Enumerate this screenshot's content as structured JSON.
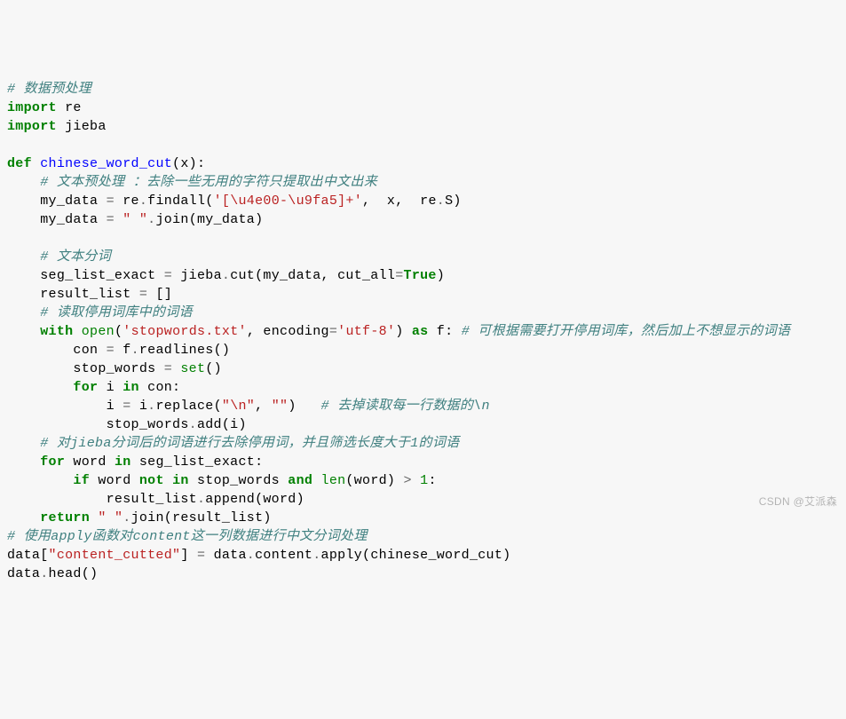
{
  "code": {
    "l1": "# 数据预处理",
    "l2a": "import",
    "l2b": " re",
    "l3a": "import",
    "l3b": " jieba",
    "l5a": "def",
    "l5b": "chinese_word_cut",
    "l6": "# 文本预处理 ：去除一些无用的字符只提取出中文出来",
    "l7a": "my_data ",
    "l7b": "=",
    "l7c": " re",
    "l7d": ".",
    "l7e": "findall(",
    "l7f": "'[\\u4e00-\\u9fa5]+'",
    "l7g": ",  x,  re",
    "l7h": ".",
    "l7i": "S)",
    "l8a": "my_data ",
    "l8b": "=",
    "l8c": " ",
    "l8d": "\" \"",
    "l8e": ".",
    "l8f": "join(my_data)",
    "l10": "# 文本分词",
    "l11a": "seg_list_exact ",
    "l11b": "=",
    "l11c": " jieba",
    "l11d": ".",
    "l11e": "cut(my_data, cut_all",
    "l11f": "=",
    "l11g": "True",
    "l11h": ")",
    "l12a": "result_list ",
    "l12b": "=",
    "l12c": " []",
    "l13": "# 读取停用词库中的词语",
    "l14a": "with",
    "l14b": " ",
    "l14c": "open",
    "l14d": "(",
    "l14e": "'stopwords.txt'",
    "l14f": ", encoding",
    "l14g": "=",
    "l14h": "'utf-8'",
    "l14i": ") ",
    "l14j": "as",
    "l14k": " f: ",
    "l14l": "# 可根据需要打开停用词库，然后加上不想显示的词语",
    "l15a": "con ",
    "l15b": "=",
    "l15c": " f",
    "l15d": ".",
    "l15e": "readlines()",
    "l16a": "stop_words ",
    "l16b": "=",
    "l16c": " ",
    "l16d": "set",
    "l16e": "()",
    "l17a": "for",
    "l17b": " i ",
    "l17c": "in",
    "l17d": " con:",
    "l18a": "i ",
    "l18b": "=",
    "l18c": " i",
    "l18d": ".",
    "l18e": "replace(",
    "l18f": "\"\\n\"",
    "l18g": ", ",
    "l18h": "\"\"",
    "l18i": ")   ",
    "l18j": "# 去掉读取每一行数据的\\n",
    "l19a": "stop_words",
    "l19b": ".",
    "l19c": "add(i)",
    "l20": "# 对jieba分词后的词语进行去除停用词，并且筛选长度大于1的词语",
    "l21a": "for",
    "l21b": " word ",
    "l21c": "in",
    "l21d": " seg_list_exact:",
    "l22a": "if",
    "l22b": " word ",
    "l22c": "not",
    "l22d": " ",
    "l22e": "in",
    "l22f": " stop_words ",
    "l22g": "and",
    "l22h": " ",
    "l22i": "len",
    "l22j": "(word) ",
    "l22k": ">",
    "l22l": " ",
    "l22m": "1",
    "l22n": ":",
    "l23a": "result_list",
    "l23b": ".",
    "l23c": "append(word)",
    "l24a": "return",
    "l24b": " ",
    "l24c": "\" \"",
    "l24d": ".",
    "l24e": "join(result_list)",
    "l25": "# 使用apply函数对content这一列数据进行中文分词处理",
    "l26a": "data[",
    "l26b": "\"content_cutted\"",
    "l26c": "] ",
    "l26d": "=",
    "l26e": " data",
    "l26f": ".",
    "l26g": "content",
    "l26h": ".",
    "l26i": "apply(chinese_word_cut)",
    "l27a": "data",
    "l27b": ".",
    "l27c": "head()"
  },
  "watermark": "CSDN @艾派森"
}
